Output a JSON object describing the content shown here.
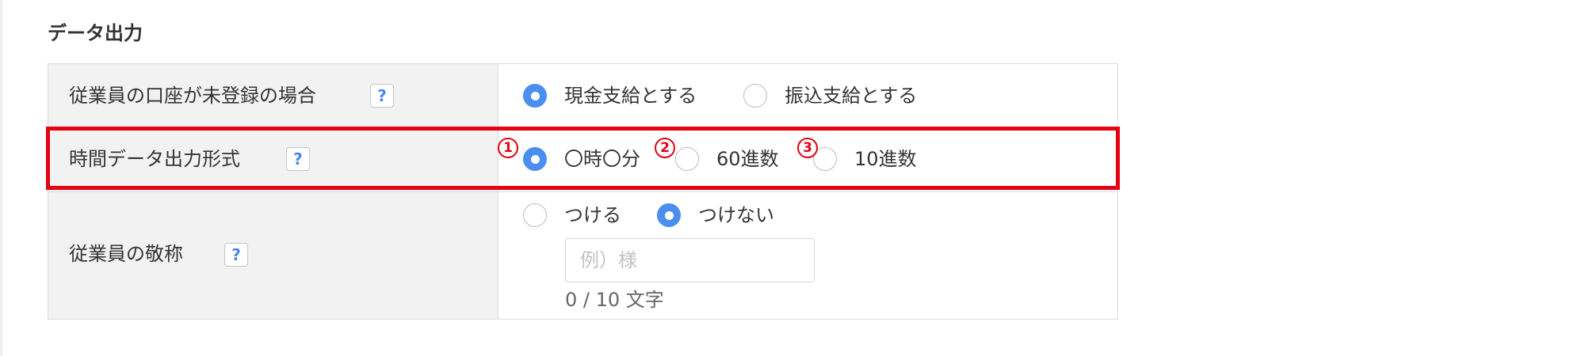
{
  "section": {
    "title": "データ出力"
  },
  "rows": [
    {
      "label": "従業員の口座が未登録の場合",
      "help": "?",
      "options": [
        {
          "label": "現金支給とする",
          "checked": true
        },
        {
          "label": "振込支給とする",
          "checked": false
        }
      ]
    },
    {
      "label": "時間データ出力形式",
      "help": "?",
      "highlighted": true,
      "markers": [
        "1",
        "2",
        "3"
      ],
      "options": [
        {
          "label": "〇時〇分",
          "checked": true
        },
        {
          "label": "60進数",
          "checked": false
        },
        {
          "label": "10進数",
          "checked": false
        }
      ]
    },
    {
      "label": "従業員の敬称",
      "help": "?",
      "options": [
        {
          "label": "つける",
          "checked": false
        },
        {
          "label": "つけない",
          "checked": true
        }
      ],
      "input": {
        "placeholder": "例）様",
        "value": ""
      },
      "counter": "0 / 10 文字"
    }
  ],
  "colors": {
    "accent": "#4a8ff0",
    "highlight": "#e60012",
    "label_background": "#f2f2f2",
    "border": "#dddddd"
  }
}
